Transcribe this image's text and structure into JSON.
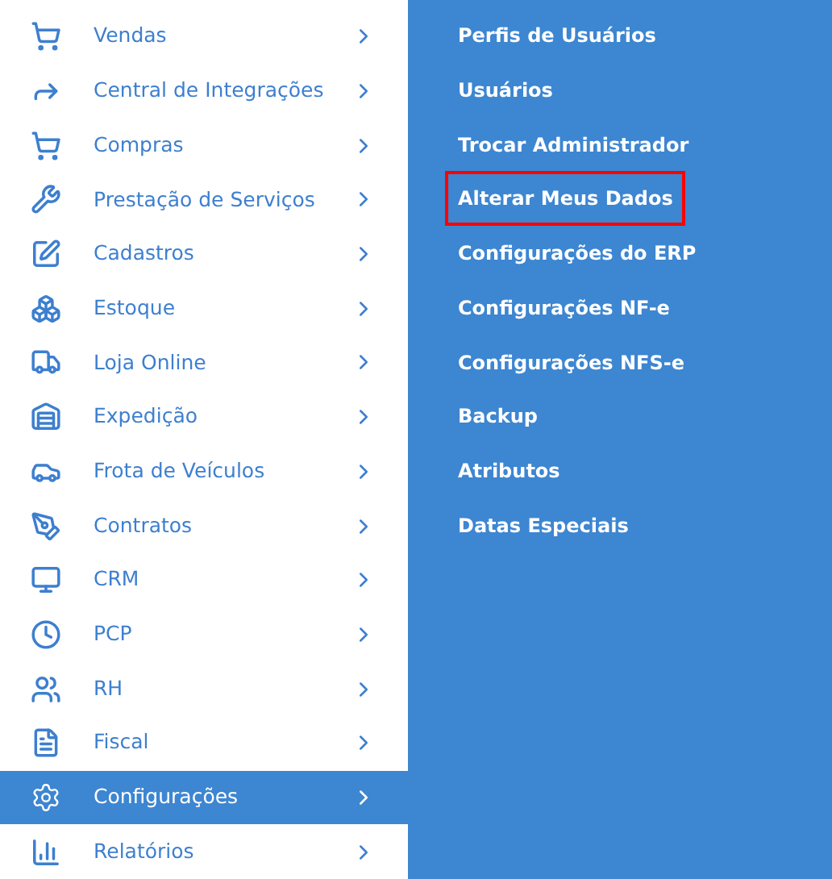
{
  "menu": [
    {
      "label": "Vendas",
      "selected": false
    },
    {
      "label": "Central de Integrações",
      "selected": false
    },
    {
      "label": "Compras",
      "selected": false
    },
    {
      "label": "Prestação de Serviços",
      "selected": false
    },
    {
      "label": "Cadastros",
      "selected": false
    },
    {
      "label": "Estoque",
      "selected": false
    },
    {
      "label": "Loja Online",
      "selected": false
    },
    {
      "label": "Expedição",
      "selected": false
    },
    {
      "label": "Frota de Veículos",
      "selected": false
    },
    {
      "label": "Contratos",
      "selected": false
    },
    {
      "label": "CRM",
      "selected": false
    },
    {
      "label": "PCP",
      "selected": false
    },
    {
      "label": "RH",
      "selected": false
    },
    {
      "label": "Fiscal",
      "selected": false
    },
    {
      "label": "Configurações",
      "selected": true
    },
    {
      "label": "Relatórios",
      "selected": false
    }
  ],
  "submenu": [
    {
      "label": "Perfis de Usuários",
      "highlighted": false
    },
    {
      "label": "Usuários",
      "highlighted": false
    },
    {
      "label": "Trocar Administrador",
      "highlighted": false
    },
    {
      "label": "Alterar Meus Dados",
      "highlighted": true
    },
    {
      "label": "Configurações do ERP",
      "highlighted": false
    },
    {
      "label": "Configurações NF-e",
      "highlighted": false
    },
    {
      "label": "Configurações NFS-e",
      "highlighted": false
    },
    {
      "label": "Backup",
      "highlighted": false
    },
    {
      "label": "Atributos",
      "highlighted": false
    },
    {
      "label": "Datas Especiais",
      "highlighted": false
    }
  ]
}
